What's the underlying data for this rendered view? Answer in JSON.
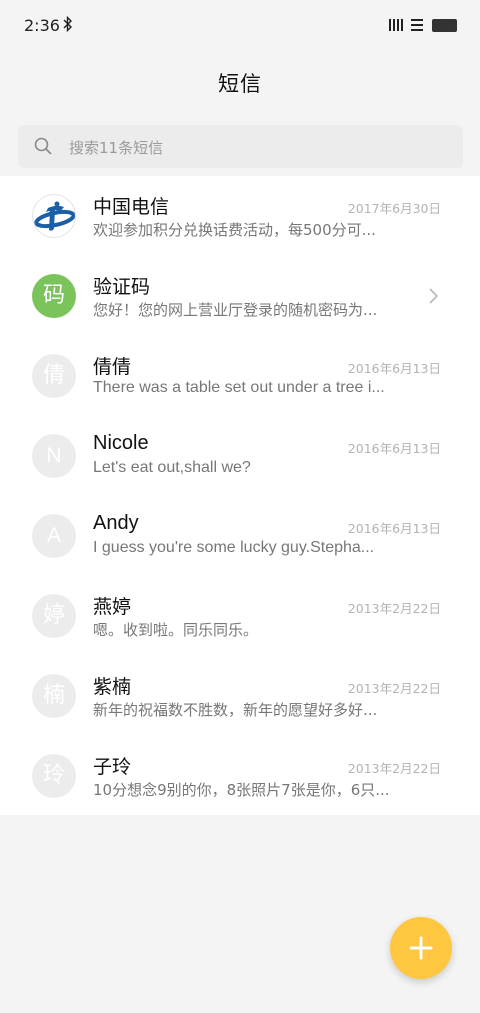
{
  "status_bar": {
    "time": "2:36",
    "icons": [
      "bluetooth-icon",
      "signal-icon",
      "wifi-icon",
      "battery-icon"
    ]
  },
  "header": {
    "title": "短信"
  },
  "search": {
    "placeholder": "搜索11条短信"
  },
  "colors": {
    "fab": "#ffc63f",
    "verify_avatar": "#7ac45b",
    "telecom_blue": "#1b5fa8"
  },
  "messages": [
    {
      "name": "中国电信",
      "date": "2017年6月30日",
      "preview": "欢迎参加积分兑换话费活动，每500分可...",
      "avatar": "china-telecom-logo"
    },
    {
      "name": "验证码",
      "date": "",
      "preview": "您好！您的网上营业厅登录的随机密码为...",
      "avatar_text": "码"
    },
    {
      "name": "倩倩",
      "date": "2016年6月13日",
      "preview": "There was a table set out under a tree i...",
      "avatar_text": "倩"
    },
    {
      "name": "Nicole",
      "date": "2016年6月13日",
      "preview": "Let's eat out,shall we?",
      "avatar_text": "N"
    },
    {
      "name": "Andy",
      "date": "2016年6月13日",
      "preview": "I guess you're some lucky guy.Stepha...",
      "avatar_text": "A"
    },
    {
      "name": "燕婷",
      "date": "2013年2月22日",
      "preview": "嗯。收到啦。同乐同乐。",
      "avatar_text": "婷"
    },
    {
      "name": "紫楠",
      "date": "2013年2月22日",
      "preview": "新年的祝福数不胜数，新年的愿望好多好...",
      "avatar_text": "楠"
    },
    {
      "name": "子玲",
      "date": "2013年2月22日",
      "preview": "10分想念9别的你，8张照片7张是你，6只...",
      "avatar_text": "玲"
    }
  ],
  "fab": {
    "icon": "plus-icon"
  }
}
